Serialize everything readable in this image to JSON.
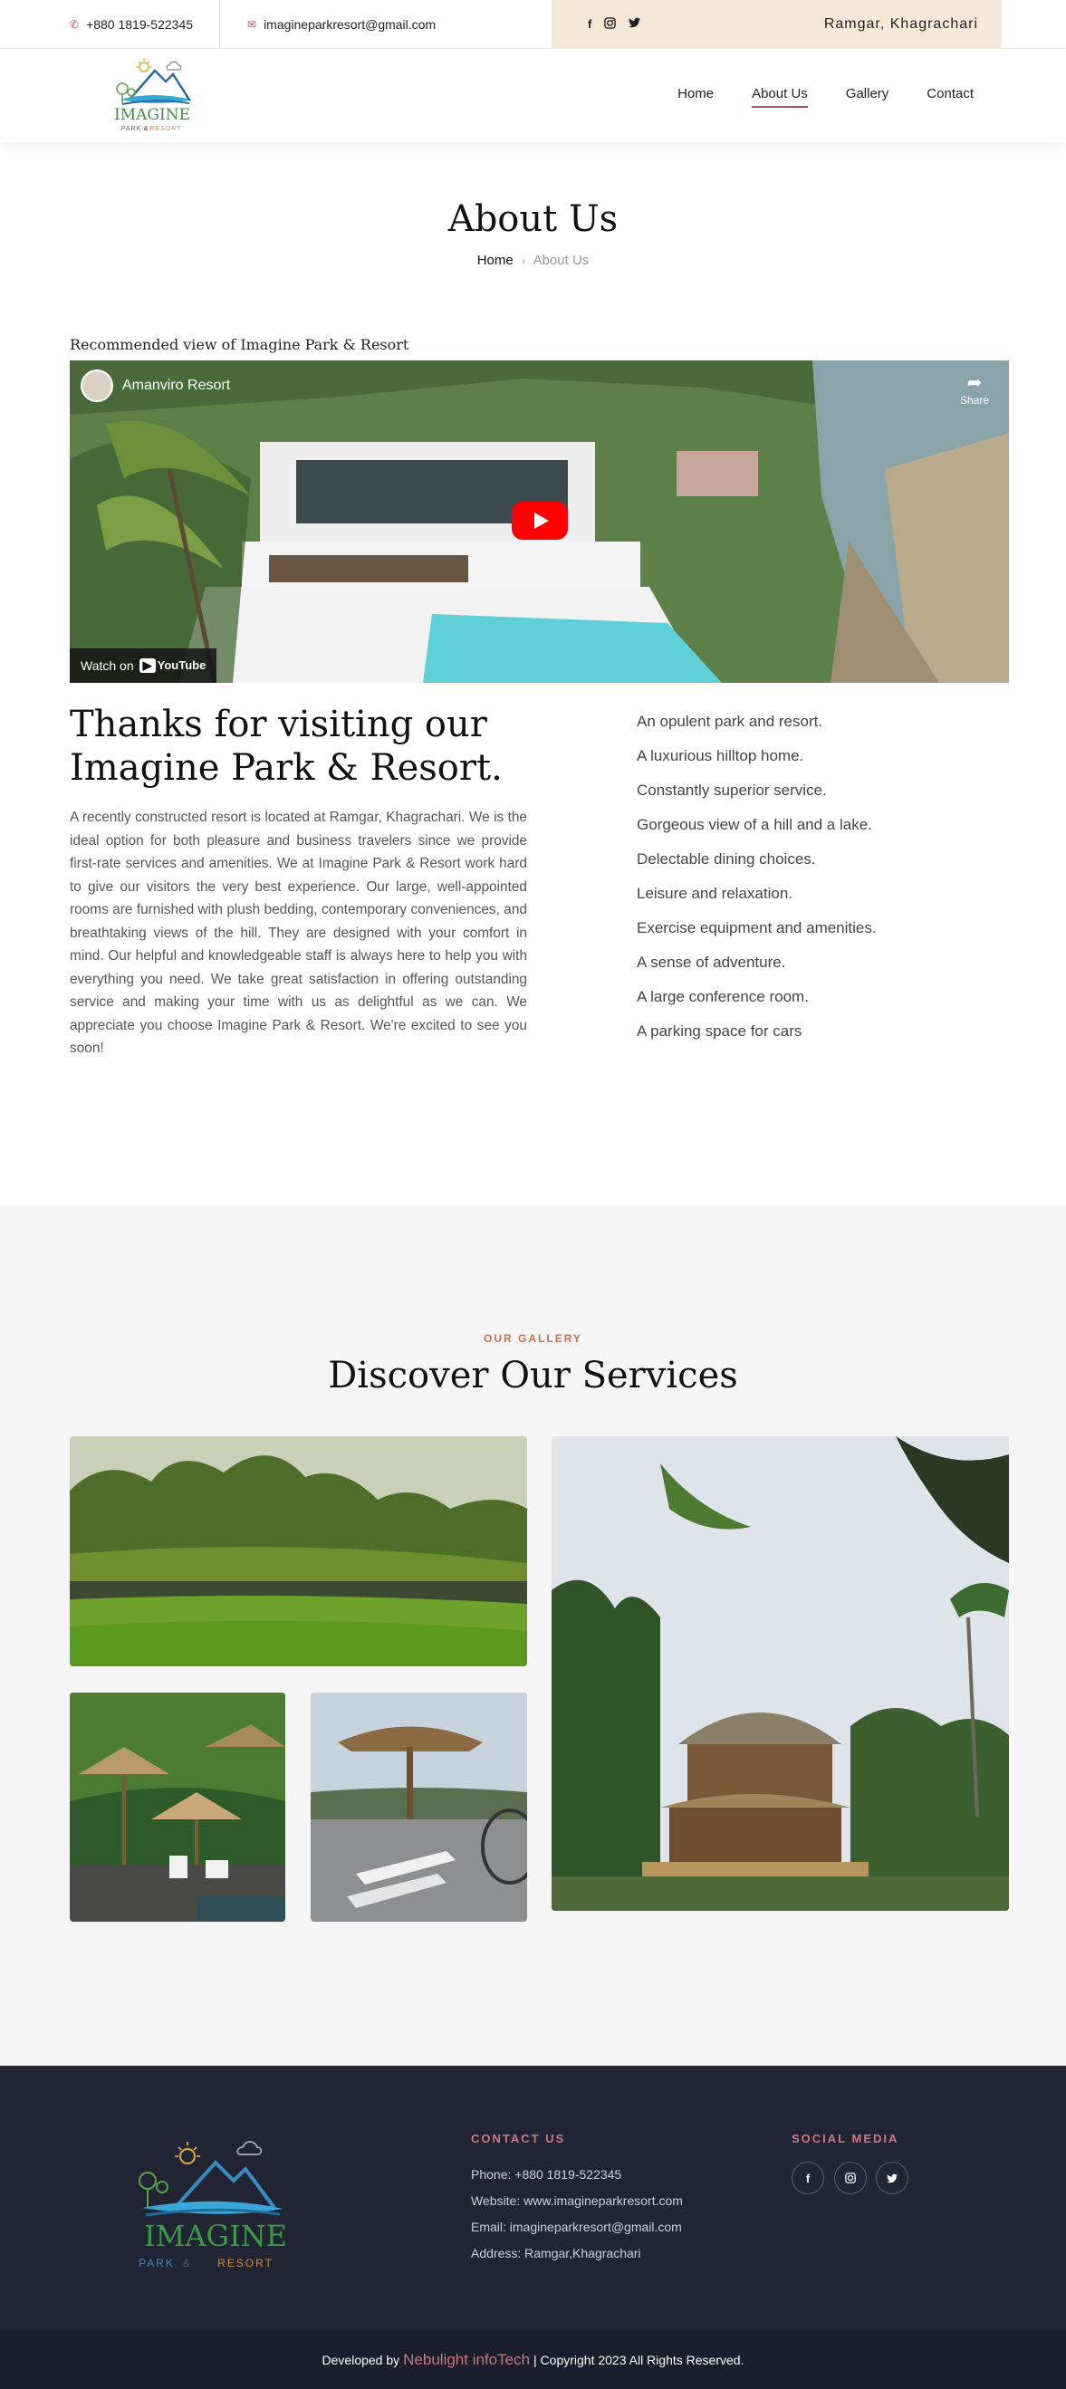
{
  "topbar": {
    "phone": "+880 1819-522345",
    "email": "imagineparkresort@gmail.com",
    "location": "Ramgar, Khagrachari",
    "social_icons": [
      "facebook-icon",
      "instagram-icon",
      "twitter-icon"
    ]
  },
  "logo": {
    "word": "IMAGINE",
    "sub1": "PARK",
    "amp": "&",
    "sub2": "RESORT"
  },
  "nav": {
    "items": [
      {
        "label": "Home",
        "active": false
      },
      {
        "label": "About Us",
        "active": true
      },
      {
        "label": "Gallery",
        "active": false
      },
      {
        "label": "Contact",
        "active": false
      }
    ]
  },
  "page_header": {
    "title": "About Us",
    "breadcrumb_home": "Home",
    "breadcrumb_current": "About Us"
  },
  "video": {
    "caption": "Recommended view of Imagine Park & Resort",
    "channel": "Amanviro Resort",
    "share": "Share",
    "watch_on": "Watch on",
    "platform": "YouTube"
  },
  "intro": {
    "title": "Thanks for visiting our Imagine Park & Resort.",
    "text": "A recently constructed resort is located at Ramgar, Khagrachari. We is the ideal option for both pleasure and business travelers since we provide first-rate services and amenities. We at Imagine Park & Resort work hard to give our visitors the very best experience. Our large, well-appointed rooms are furnished with plush bedding, contemporary conveniences, and breathtaking views of the hill. They are designed with your comfort in mind. Our helpful and knowledgeable staff is always here to help you with everything you need. We take great satisfaction in offering outstanding service and making your time with us as delightful as we can. We appreciate you choose Imagine Park & Resort. We're excited to see you soon!",
    "features": [
      "An opulent park and resort.",
      "A luxurious hilltop home.",
      "Constantly superior service.",
      "Gorgeous view of a hill and a lake.",
      "Delectable dining choices.",
      "Leisure and relaxation.",
      "Exercise equipment and amenities.",
      "A sense of adventure.",
      "A large conference room.",
      "A parking space for cars"
    ]
  },
  "gallery": {
    "eyebrow": "OUR GALLERY",
    "title": "Discover Our Services"
  },
  "footer": {
    "contact_heading": "CONTACT US",
    "phone": "Phone: +880 1819-522345",
    "website": "Website: www.imagineparkresort.com",
    "email": "Email: imagineparkresort@gmail.com",
    "address": "Address: Ramgar,Khagrachari",
    "social_heading": "SOCIAL MEDIA",
    "social_icons": [
      "facebook-icon",
      "instagram-icon",
      "twitter-icon"
    ]
  },
  "copyright": {
    "prefix": "Developed by",
    "developer": "Nebulight infoTech",
    "suffix": "| Copyright 2023 All Rights Reserved."
  },
  "colors": {
    "accent": "#b5485f",
    "topbar_highlight": "#f5e8d8",
    "footer_bg": "#212433",
    "gallery_bg": "#f5f5f5"
  }
}
